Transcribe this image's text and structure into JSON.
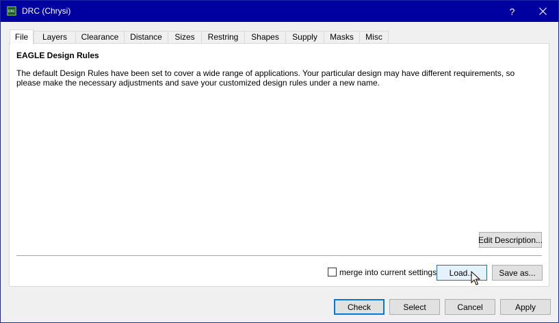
{
  "window": {
    "title": "DRC (Chrysi)",
    "help_label": "?",
    "icon": "drc-app-icon"
  },
  "tabs": [
    {
      "label": "File",
      "active": true
    },
    {
      "label": "Layers"
    },
    {
      "label": "Clearance"
    },
    {
      "label": "Distance"
    },
    {
      "label": "Sizes"
    },
    {
      "label": "Restring"
    },
    {
      "label": "Shapes"
    },
    {
      "label": "Supply"
    },
    {
      "label": "Masks"
    },
    {
      "label": "Misc"
    }
  ],
  "file_tab": {
    "title": "EAGLE Design Rules",
    "description": "The default Design Rules have been set to cover a wide range of applications. Your particular design may have different requirements, so please make the necessary adjustments and save your customized design rules under a new name.",
    "edit_description_label": "Edit Description...",
    "merge_label": "merge into current settings",
    "merge_checked": false,
    "load_label": "Load...",
    "save_as_label": "Save as..."
  },
  "footer": {
    "check_label": "Check",
    "select_label": "Select",
    "cancel_label": "Cancel",
    "apply_label": "Apply"
  },
  "colors": {
    "titlebar": "#0000a0",
    "focus_border": "#0078d7"
  }
}
